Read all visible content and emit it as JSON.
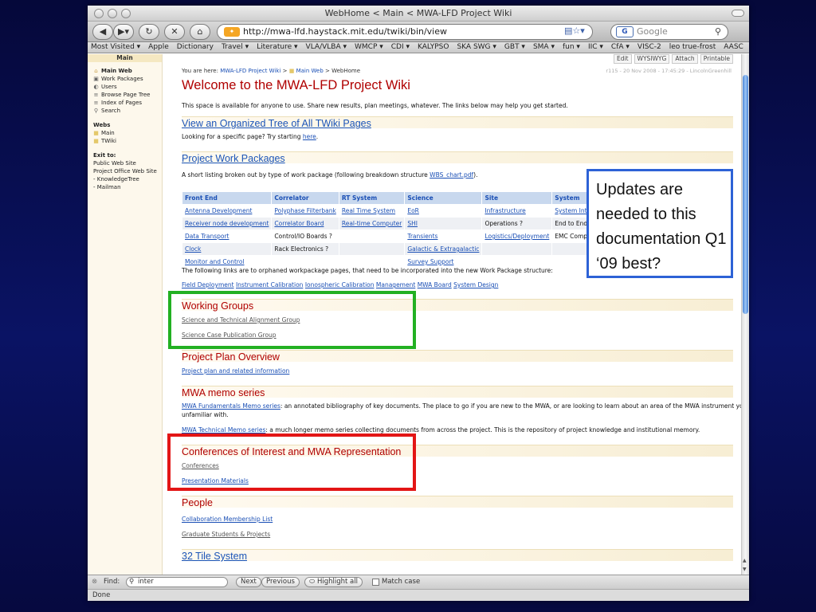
{
  "window": {
    "title": "WebHome < Main < MWA-LFD Project Wiki",
    "url": "http://mwa-lfd.haystack.mit.edu/twiki/bin/view",
    "search_placeholder": "Google",
    "search_engine_glyph": "G"
  },
  "bookmarks": [
    "Most Visited ▾",
    "Apple",
    "Dictionary",
    "Travel ▾",
    "Literature ▾",
    "VLA/VLBA ▾",
    "WMCP ▾",
    "CDI ▾",
    "KALYPSO",
    "SKA SWG ▾",
    "GBT ▾",
    "SMA ▾",
    "fun ▾",
    "IIC ▾",
    "CfA ▾",
    "VISC-2",
    "leo true-frost",
    "AASC"
  ],
  "sidebar": {
    "header": "Main",
    "items": [
      {
        "label": "Main Web",
        "icon": "home-icon",
        "glyph": "⌂"
      },
      {
        "label": "Work Packages",
        "icon": "package-icon",
        "glyph": "▣"
      },
      {
        "label": "Users",
        "icon": "users-icon",
        "glyph": "◐"
      },
      {
        "label": "Browse Page Tree",
        "icon": "tree-icon",
        "glyph": "≡"
      },
      {
        "label": "Index of Pages",
        "icon": "index-icon",
        "glyph": "≡"
      },
      {
        "label": "Search",
        "icon": "search-icon",
        "glyph": "⚲"
      }
    ],
    "webs_heading": "Webs",
    "webs": [
      "Main",
      "TWiki"
    ],
    "exit_heading": "Exit to:",
    "exit_links": [
      "Public Web Site",
      "Project Office Web Site",
      "- KnowledgeTree",
      "- Mailman"
    ]
  },
  "toolbar": [
    "Edit",
    "WYSIWYG",
    "Attach",
    "Printable"
  ],
  "breadcrumb": {
    "prefix": "You are here:",
    "items": [
      "MWA-LFD Project Wiki",
      ">",
      "Main Web",
      "> WebHome"
    ]
  },
  "revision": "r115 - 20 Nov 2008 - 17:45:29 - LincolnGreenhill",
  "page_title": "Welcome to the MWA-LFD Project Wiki",
  "intro": "This space is available for anyone to use. Share new results, plan meetings, whatever. The links below may help you get started.",
  "organized_tree": {
    "heading": "View an Organized Tree of All TWiki Pages",
    "text": "Looking for a specific page? Try starting",
    "link": "here",
    "suffix": "."
  },
  "work_packages": {
    "heading": "Project Work Packages",
    "text_before": "A short listing broken out by type of work package (following breakdown structure",
    "link": "WBS_chart.pdf",
    "text_after": ").",
    "columns": [
      "Front End",
      "Correlator",
      "RT System",
      "Science",
      "Site",
      "System"
    ],
    "rows": [
      [
        {
          "t": "Antenna Development",
          "l": true
        },
        {
          "t": "Polyphase Filterbank",
          "l": true
        },
        {
          "t": "Real Time System",
          "l": true
        },
        {
          "t": "EoR",
          "l": true
        },
        {
          "t": "Infrastructure",
          "l": true
        },
        {
          "t": "System Integration",
          "l": true
        }
      ],
      [
        {
          "t": "Receiver node development",
          "l": true
        },
        {
          "t": "Correlator Board",
          "l": true
        },
        {
          "t": "Real-time Computer",
          "l": true
        },
        {
          "t": "SHI",
          "l": true
        },
        {
          "t": "Operations ?",
          "l": false
        },
        {
          "t": "End to End ?",
          "l": false
        }
      ],
      [
        {
          "t": "Data Transport",
          "l": true
        },
        {
          "t": "Control/IO Boards ?",
          "l": false
        },
        {
          "t": "",
          "l": false
        },
        {
          "t": "Transients",
          "l": true
        },
        {
          "t": "Logistics/Deployment",
          "l": true
        },
        {
          "t": "EMC Compliance ?",
          "l": false
        }
      ],
      [
        {
          "t": "Clock",
          "l": true
        },
        {
          "t": "Rack Electronics ?",
          "l": false
        },
        {
          "t": "",
          "l": false
        },
        {
          "t": "Galactic & Extragalactic",
          "l": true
        },
        {
          "t": "",
          "l": false
        },
        {
          "t": "",
          "l": false
        }
      ],
      [
        {
          "t": "Monitor and Control",
          "l": true
        },
        {
          "t": "",
          "l": false
        },
        {
          "t": "",
          "l": false
        },
        {
          "t": "Survey Support",
          "l": true
        },
        {
          "t": "",
          "l": false
        },
        {
          "t": "",
          "l": false
        }
      ]
    ],
    "orphan_text": "The following links are to orphaned workpackage pages, that need to be incorporated into the new Work Package structure:",
    "orphan_links": [
      "Field Deployment",
      "Instrument Calibration",
      "Ionospheric Calibration",
      "Management",
      "MWA Board",
      "System Design"
    ]
  },
  "working_groups": {
    "heading": "Working Groups",
    "links": [
      "Science and Technical Alignment Group",
      "Science Case Publication Group"
    ]
  },
  "project_plan": {
    "heading": "Project Plan Overview",
    "link": "Project plan and related information"
  },
  "memo_series": {
    "heading": "MWA memo series",
    "fund_link": "MWA Fundamentals Memo series",
    "fund_text": ": an annotated bibliography of key documents. The place to go if you are new to the MWA, or are looking to learn about an area of the MWA instrument you are",
    "fund_text2": "unfamiliar with.",
    "tech_link": "MWA Technical Memo series",
    "tech_text": ": a much longer memo series collecting documents from across the project. This is the repository of project knowledge and institutional memory."
  },
  "conferences": {
    "heading": "Conferences of Interest and MWA Representation",
    "links": [
      "Conferences",
      "Presentation Materials"
    ]
  },
  "people": {
    "heading": "People",
    "links": [
      "Collaboration Membership List",
      "Graduate Students & Projects"
    ]
  },
  "tile_system": {
    "heading": "32 Tile System"
  },
  "findbar": {
    "label": "Find:",
    "value": "inter",
    "next": "Next",
    "previous": "Previous",
    "highlight": "Highlight all",
    "match_case": "Match case"
  },
  "status": "Done",
  "annotation": "Updates are needed to this documentation Q1 ‘09  best?",
  "colors": {
    "annotation_blue": "#2d62d6",
    "annotation_green": "#22b022",
    "annotation_red": "#e31515",
    "heading_red": "#b00000",
    "link_blue": "#1a4fb5"
  }
}
